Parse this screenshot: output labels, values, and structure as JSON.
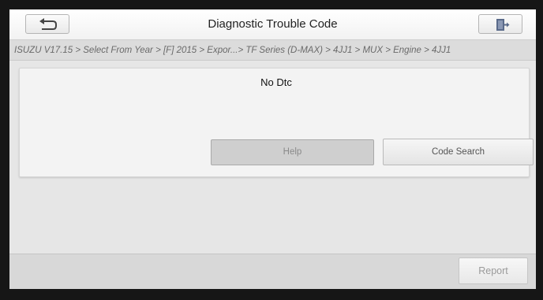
{
  "header": {
    "title": "Diagnostic Trouble Code",
    "back_icon": "back-arrow-icon",
    "exit_icon": "exit-door-icon"
  },
  "breadcrumb": {
    "path": "ISUZU V17.15 > Select From Year > [F] 2015 > Expor...> TF Series (D-MAX) > 4JJ1 > MUX > Engine > 4JJ1"
  },
  "result": {
    "message": "No Dtc"
  },
  "buttons": {
    "help": "Help",
    "code_search": "Code Search",
    "report": "Report"
  },
  "colors": {
    "screen_bg": "#e6e6e6",
    "topbar_bg": "#f7f7f7",
    "panel_bg": "#f3f3f3",
    "help_disabled_bg": "#cfcfcf",
    "exit_icon_color": "#5a6a8a"
  }
}
